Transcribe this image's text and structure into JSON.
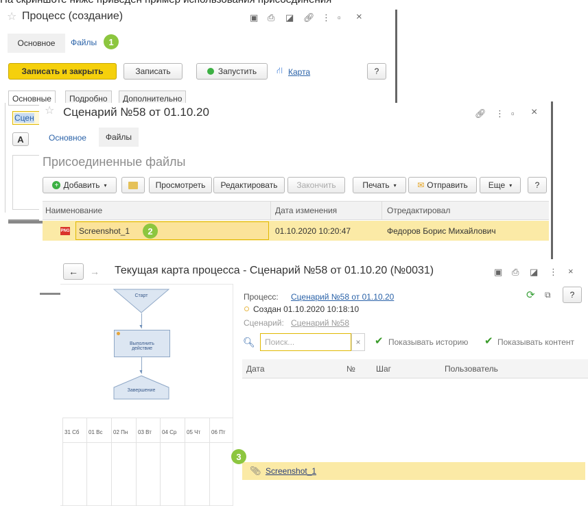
{
  "caption": "На скриншоте ниже приведен пример использования присоединения",
  "colors": {
    "accent_yellow": "#f5d00c",
    "badge_green": "#8cc63f",
    "link_blue": "#2a62a8",
    "selection": "#fbeaa6"
  },
  "win1": {
    "title": "Процесс (создание)",
    "tabs": [
      "Основное",
      "Файлы"
    ],
    "badge": "1",
    "buttons": {
      "save_close": "Записать и закрыть",
      "save": "Записать",
      "start": "Запустить",
      "map": "Карта",
      "help": "?"
    },
    "subtabs": [
      "Основные",
      "Подробно",
      "Дополнительно"
    ],
    "field_fragment": "Сцен",
    "format_button": "A"
  },
  "win2": {
    "title": "Сценарий №58 от 01.10.20",
    "tabs": [
      "Основное",
      "Файлы"
    ],
    "section_title": "Присоединенные файлы",
    "toolbar": {
      "add": "Добавить",
      "view": "Просмотреть",
      "edit": "Редактировать",
      "finish": "Закончить",
      "print": "Печать",
      "send": "Отправить",
      "more": "Еще",
      "help": "?"
    },
    "columns": [
      "Наименование",
      "Дата изменения",
      "Отредактировал"
    ],
    "row": {
      "name": "Screenshot_1",
      "date": "01.10.2020 10:20:47",
      "editor": "Федоров Борис Михайлович"
    },
    "badge": "2",
    "file_icon_label": "PNG"
  },
  "win3": {
    "title": "Текущая карта процесса - Сценарий №58 от 01.10.20 (№0031)",
    "diagram": {
      "start": "Старт",
      "action": "Выполнить действие",
      "end": "Завершение"
    },
    "days": [
      "31 Сб",
      "01 Вс",
      "02 Пн",
      "03 Вт",
      "04 Ср",
      "05 Чт",
      "06 Пт"
    ],
    "process_label": "Процесс:",
    "process_link": "Сценарий №58 от 01.10.20",
    "created": "Создан 01.10.2020 10:18:10",
    "scenario_label": "Сценарий:",
    "scenario_link": "Сценарий №58",
    "search_placeholder": "Поиск...",
    "show_history": "Показывать историю",
    "show_content": "Показывать контент",
    "columns": [
      "Дата",
      "№",
      "Шаг",
      "Пользователь"
    ],
    "attachment": "Screenshot_1",
    "badge": "3",
    "help": "?"
  }
}
